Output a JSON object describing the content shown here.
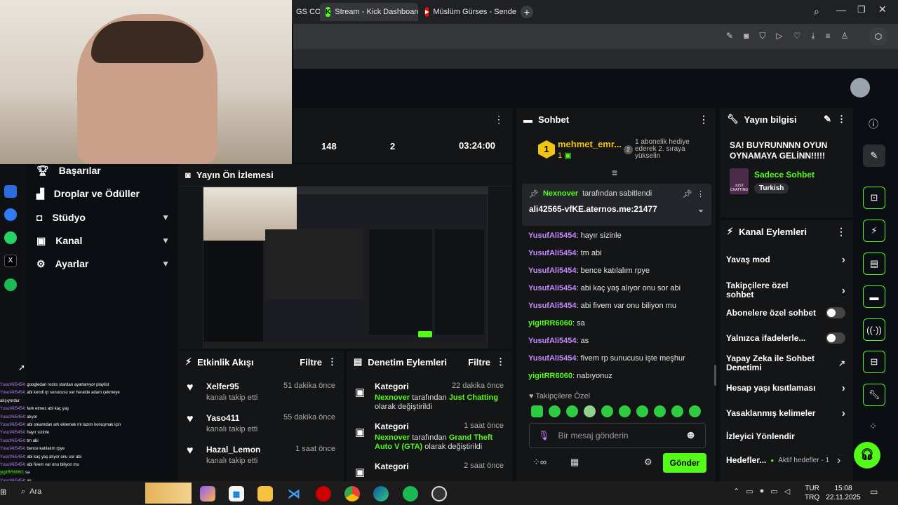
{
  "browser": {
    "tabs": [
      {
        "label": "GS COG",
        "icon": "tab-icon"
      },
      {
        "label": "Stream - Kick Dashboard",
        "icon": "kick-icon"
      },
      {
        "label": "Müslüm Gürses - Senden V",
        "icon": "youtube-icon"
      }
    ],
    "new_tab": "+"
  },
  "stats": [
    "148",
    "2",
    "03:24:00"
  ],
  "sidebar": {
    "items": [
      {
        "label": "Başarılar",
        "icon": "trophy-icon",
        "chevron": false
      },
      {
        "label": "Droplar ve Ödüller",
        "icon": "gift-icon",
        "chevron": false
      },
      {
        "label": "Stüdyo",
        "icon": "studio-icon",
        "chevron": true
      },
      {
        "label": "Kanal",
        "icon": "channel-icon",
        "chevron": true
      },
      {
        "label": "Ayarlar",
        "icon": "gear-icon",
        "chevron": true
      }
    ]
  },
  "preview": {
    "title": "Yayın Ön İzlemesi"
  },
  "chat": {
    "title": "Sohbet",
    "top_user": "mehmet_emr...",
    "top_rank": "1",
    "top_count": "1",
    "gift_note": "1 abonelik hediye ederek 2. sıraya yükselin",
    "pinned_by": "Nexnover",
    "pinned_suffix": "tarafından sabitlendi",
    "pinned_text": "ali42565-vfKE.aternos.me:21477",
    "messages": [
      {
        "user": "YusufAli5454",
        "text": "hayır sizinle",
        "green": false
      },
      {
        "user": "YusufAli5454",
        "text": "tm abi",
        "green": false
      },
      {
        "user": "YusufAli5454",
        "text": "bence katılalım rpye",
        "green": false
      },
      {
        "user": "YusufAli5454",
        "text": "abi kaç yaş alıyor onu sor abi",
        "green": false
      },
      {
        "user": "YusufAli5454",
        "text": "abi fivem var onu biliyon mu",
        "green": false
      },
      {
        "user": "yigitRR6060",
        "text": "sa",
        "green": true
      },
      {
        "user": "YusufAli5454",
        "text": "as",
        "green": false
      },
      {
        "user": "YusufAli5454",
        "text": "fivem rp sunucusu işte meşhur",
        "green": false
      },
      {
        "user": "yigitRR6060",
        "text": "nabıyonuz",
        "green": true
      }
    ],
    "followers_only": "Takipçilere Özel",
    "placeholder": "Bir mesaj gönderin",
    "send": "Gönder",
    "accent": "#53fc18"
  },
  "stream_info": {
    "title": "Yayın bilgisi",
    "stream_title": "SA! BUYRUNNNN OYUN OYNAMAYA GELİNN!!!!!",
    "category": "Sadece Sohbet",
    "category_thumb": "JUST CHATTING",
    "language": "Turkish"
  },
  "channel_actions": {
    "title": "Kanal Eylemleri",
    "items": [
      {
        "label": "Yavaş mod",
        "control": "chevron"
      },
      {
        "label": "Takipçilere özel sohbet",
        "control": "chevron"
      },
      {
        "label": "Abonelere özel sohbet",
        "control": "toggle"
      },
      {
        "label": "Yalnızca ifadelerle...",
        "control": "toggle"
      },
      {
        "label": "Yapay Zeka ile Sohbet Denetimi",
        "control": "external"
      },
      {
        "label": "Hesap yaşı kısıtlaması",
        "control": "chevron"
      },
      {
        "label": "Yasaklanmış kelimeler",
        "control": "chevron"
      },
      {
        "label": "İzleyici Yönlendir",
        "control": "none"
      }
    ],
    "goals_label": "Hedefler...",
    "goals_active": "Aktif hedefler - 1"
  },
  "activity": {
    "title": "Etkinlik Akışı",
    "filter": "Filtre",
    "items": [
      {
        "name": "Xelfer95",
        "sub": "kanalı takip etti",
        "time": "51 dakika önce"
      },
      {
        "name": "Yaso411",
        "sub": "kanalı takip etti",
        "time": "55 dakika önce"
      },
      {
        "name": "Hazal_Lemon",
        "sub": "kanalı takip etti",
        "time": "1 saat önce"
      }
    ]
  },
  "moderation": {
    "title": "Denetim Eylemleri",
    "filter": "Filtre",
    "items": [
      {
        "title": "Kategori",
        "time": "22 dakika önce",
        "who": "Nexnover",
        "mid": "tarafından",
        "what": "Just Chatting",
        "tail": "olarak değiştirildi"
      },
      {
        "title": "Kategori",
        "time": "1 saat önce",
        "who": "Nexnover",
        "mid": "tarafından",
        "what": "Grand Theft Auto V (GTA)",
        "tail": "olarak değiştirildi"
      },
      {
        "title": "Kategori",
        "time": "2 saat önce",
        "who": "",
        "mid": "",
        "what": "",
        "tail": ""
      }
    ]
  },
  "overlay_chat": [
    {
      "user": "YusufAli5454",
      "text": ": googledan rocks stardan ayarlanıyor playlist",
      "green": false
    },
    {
      "user": "YusufAli5454",
      "text": ": abi kendi rp sunucusu var heralde adam çekmeye",
      "green": false
    },
    {
      "user": "",
      "text": "alışıyordur",
      "green": false
    },
    {
      "user": "YusufAli5454",
      "text": ": fark etmez abi kaç yaş",
      "green": false
    },
    {
      "user": "YusufAli5454",
      "text": ": alıyor",
      "green": false
    },
    {
      "user": "YusufAli5454",
      "text": ": abi steamdan ark eklemek mi lazım konuşmak için",
      "green": false
    },
    {
      "user": "YusufAli5454",
      "text": ": hayır sizinle",
      "green": false
    },
    {
      "user": "YusufAli5454",
      "text": ": tm abi",
      "green": false
    },
    {
      "user": "YusufAli5454",
      "text": ": bence katılalım rpye",
      "green": false
    },
    {
      "user": "YusufAli5454",
      "text": ": abi kaç yaş alıyor onu sor abi",
      "green": false
    },
    {
      "user": "YusufAli5454",
      "text": ": abi fivem var onu biliyon mu",
      "green": false
    },
    {
      "user": "yigitRR6060",
      "text": ": sa",
      "green": true
    },
    {
      "user": "YusufAli5454",
      "text": ": as",
      "green": false
    }
  ],
  "taskbar": {
    "search": "Ara",
    "lang1": "TUR",
    "lang2": "TRQ",
    "time": "15:08",
    "date": "22.11.2025"
  }
}
